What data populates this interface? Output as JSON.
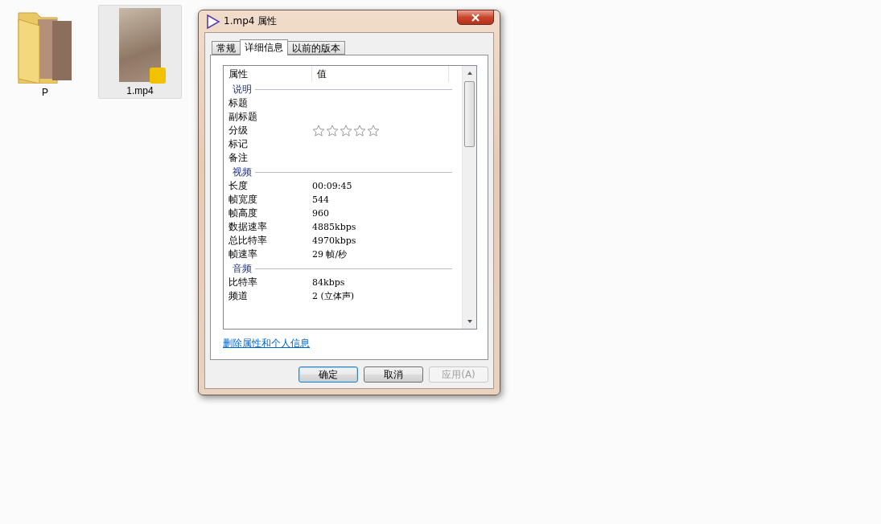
{
  "desktop_items": [
    {
      "label": "P",
      "kind": "folder",
      "selected": false
    },
    {
      "label": "1.mp4",
      "kind": "video",
      "selected": true
    }
  ],
  "dialog": {
    "title": "1.mp4 属性",
    "tabs": [
      {
        "label": "常规",
        "selected": false
      },
      {
        "label": "详细信息",
        "selected": true
      },
      {
        "label": "以前的版本",
        "selected": false
      }
    ],
    "columns": [
      "属性",
      "值"
    ],
    "sections": [
      {
        "title": "说明",
        "rows": [
          {
            "name": "标题",
            "kind": "text"
          },
          {
            "name": "副标题",
            "kind": "text"
          },
          {
            "name": "分级",
            "kind": "rating",
            "stars": 0
          },
          {
            "name": "标记",
            "kind": "text"
          },
          {
            "name": "备注",
            "kind": "text"
          }
        ]
      },
      {
        "title": "视频",
        "rows": [
          {
            "name": "长度",
            "kind": "text",
            "value": "00:09:45"
          },
          {
            "name": "帧宽度",
            "kind": "text",
            "value": "544"
          },
          {
            "name": "帧高度",
            "kind": "text",
            "value": "960"
          },
          {
            "name": "数据速率",
            "kind": "text",
            "value": "4885kbps"
          },
          {
            "name": "总比特率",
            "kind": "text",
            "value": "4970kbps"
          },
          {
            "name": "帧速率",
            "kind": "text",
            "value": "29 帧/秒"
          }
        ]
      },
      {
        "title": "音频",
        "rows": [
          {
            "name": "比特率",
            "kind": "text",
            "value": "84kbps"
          },
          {
            "name": "频道",
            "kind": "text",
            "value": "2 (立体声)"
          }
        ]
      }
    ],
    "link": "删除属性和个人信息",
    "buttons": [
      {
        "label": "确定",
        "kind": "default",
        "disabled": false
      },
      {
        "label": "取消",
        "kind": "normal",
        "disabled": false
      },
      {
        "label": "应用(A)",
        "kind": "normal",
        "disabled": true
      }
    ]
  }
}
